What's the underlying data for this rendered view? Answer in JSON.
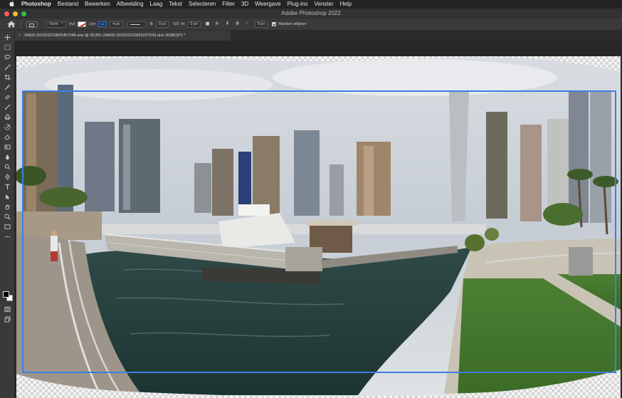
{
  "menubar": {
    "apple": "",
    "app": "Photoshop",
    "items": [
      "Bestand",
      "Bewerken",
      "Afbeelding",
      "Laag",
      "Tekst",
      "Selecteren",
      "Filter",
      "3D",
      "Weergave",
      "Plug-ins",
      "Venster",
      "Help"
    ]
  },
  "window": {
    "title": "Adobe Photoshop 2022",
    "traffic_colors": [
      "#ff5f57",
      "#febc2e",
      "#28c840"
    ]
  },
  "options": {
    "mode": "Vorm",
    "fill_label": "Vul:",
    "stroke_label": "Lijn:",
    "stroke_width": "4 px",
    "width_label": "B:",
    "width_value": "0 px",
    "link_label": "GO",
    "height_label": "H:",
    "height_value": "0 px",
    "radius_value": "0 px",
    "align_edges_label": "Randen uitlijnen",
    "stroke_color": "#2b72d8"
  },
  "tools": [
    "move-icon",
    "marquee-icon",
    "lasso-icon",
    "magic-wand-icon",
    "crop-icon",
    "eyedropper-icon",
    "healing-icon",
    "brush-icon",
    "clone-stamp-icon",
    "history-brush-icon",
    "eraser-icon",
    "gradient-icon",
    "blur-icon",
    "dodge-icon",
    "pen-icon",
    "type-icon",
    "path-select-icon",
    "rectangle-icon",
    "hand-icon",
    "zoom-icon",
    "more-icon"
  ],
  "document": {
    "tab_label": "JWED-20150321082545​7546.arw @ 30,8% (JWED-20150321082523​7543.arw, RGB/16*) *",
    "close": "×"
  },
  "selection": {
    "color": "#3c7fe0"
  }
}
